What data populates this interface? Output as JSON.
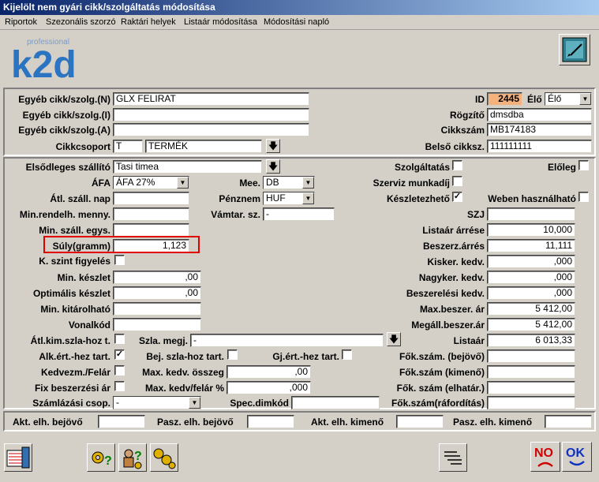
{
  "window": {
    "title": "Kijelölt nem gyári cikk/szolgáltatás módosítása"
  },
  "menu": [
    "Riportok",
    "Szezonális szorzó",
    "Raktári helyek",
    "Listaár módosítása",
    "Módosítási napló"
  ],
  "logo": {
    "small": "professional",
    "big": "k2d"
  },
  "fields": {
    "egyeb_n_label": "Egyéb cikk/szolg.(N)",
    "egyeb_n": "GLX  FELIRAT",
    "egyeb_i_label": "Egyéb cikk/szolg.(I)",
    "egyeb_i": "",
    "egyeb_a_label": "Egyéb cikk/szolg.(A)",
    "egyeb_a": "",
    "cikkcsoport_label": "Cikkcsoport",
    "cikkcsoport_code": "T",
    "cikkcsoport_name": "TERMÉK",
    "id_label": "ID",
    "id": "2445",
    "elo_label": "Élő",
    "elo": "Élő",
    "rogzito_label": "Rögzítő",
    "rogzito": "dmsdba",
    "cikkszam_label": "Cikkszám",
    "cikkszam": "MB174183",
    "belso_label": "Belső cikksz.",
    "belso": "111111111",
    "szallito_label": "Elsődleges szállító",
    "szallito": "Tasi timea",
    "afa_label": "ÁFA",
    "afa": "ÁFA 27%",
    "atl_szall_label": "Átl. száll. nap",
    "atl_szall": "",
    "min_rend_label": "Min.rendelh. menny.",
    "min_rend": "",
    "min_szall_label": "Min. száll. egys.",
    "min_szall": "",
    "suly_label": "Súly(gramm)",
    "suly": "1,123",
    "k_szint_label": "K. szint figyelés",
    "min_keszlet_label": "Min. készlet",
    "min_keszlet": ",00",
    "opt_keszlet_label": "Optimális készlet",
    "opt_keszlet": ",00",
    "min_kitar_label": "Min. kitárolható",
    "min_kitar": "",
    "vonalkod_label": "Vonalkód",
    "vonalkod": "",
    "mee_label": "Mee.",
    "mee": "DB",
    "penznem_label": "Pénznem",
    "penznem": "HUF",
    "vamtar_label": "Vámtar. sz.",
    "vamtar": "-",
    "szolg_label": "Szolgáltatás",
    "elolegs_label": "Előleg",
    "szerviz_label": "Szerviz munkadíj",
    "keszlet_label": "Készletezhető",
    "weben_label": "Weben használható",
    "szj_label": "SZJ",
    "szj": "",
    "listaar_arres_label": "Listaár árrése",
    "listaar_arres": "10,000",
    "beszerz_arres_label": "Beszerz.árrés",
    "beszerz_arres": "11,111",
    "kisker_label": "Kisker. kedv.",
    "kisker": ",000",
    "nagyker_label": "Nagyker. kedv.",
    "nagyker": ",000",
    "beszerelesi_label": "Beszerelési kedv.",
    "beszerelesi": ",000",
    "max_beszer_label": "Max.beszer. ár",
    "max_beszer": "5 412,00",
    "megall_label": "Megáll.beszer.ár",
    "megall": "5 412,00",
    "listaar_label": "Listaár",
    "listaar": "6 013,33",
    "atl_kim_label": "Átl.kim.szla-hoz t.",
    "szla_megj_label": "Szla. megj.",
    "szla_megj": "-",
    "alk_ert_label": "Alk.ért.-hez tart.",
    "bej_szla_label": "Bej. szla-hoz tart.",
    "gj_ert_label": "Gj.ért.-hez tart.",
    "kedvezm_label": "Kedvezm./Felár",
    "max_kedv_osszeg_label": "Max. kedv. összeg",
    "max_kedv_osszeg": ",00",
    "fix_beszer_label": "Fix beszerzési ár",
    "max_kedv_felar_label": "Max. kedv/felár %",
    "max_kedv_felar": ",000",
    "szamlazasi_label": "Számlázási csop.",
    "szamlazasi": "-",
    "spec_dim_label": "Spec.dimkód",
    "spec_dim": "",
    "fok_bejovo_label": "Fők.szám. (bejövő)",
    "fok_bejovo": "",
    "fok_kimeno_label": "Fők.szám (kimenő)",
    "fok_kimeno": "",
    "fok_elhatar_label": "Fők. szám (elhatár.)",
    "fok_elhatar": "",
    "fok_raford_label": "Fők.szám(ráfordítás)",
    "fok_raford": ""
  },
  "bottom": {
    "akt_bejovo_label": "Akt. elh. bejövő",
    "akt_bejovo": "",
    "pasz_bejovo_label": "Pasz. elh. bejövő",
    "pasz_bejovo": "",
    "akt_kimeno_label": "Akt. elh. kimenő",
    "akt_kimeno": "",
    "pasz_kimeno_label": "Pasz. elh. kimenő",
    "pasz_kimeno": ""
  },
  "buttons": {
    "no": "NO",
    "ok": "OK"
  }
}
